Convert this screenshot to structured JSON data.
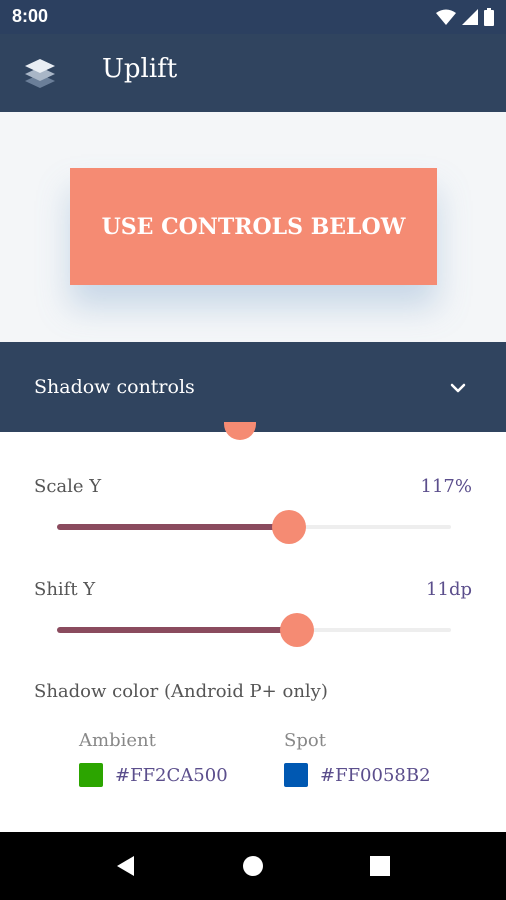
{
  "status": {
    "time": "8:00"
  },
  "app": {
    "title": "Uplift"
  },
  "preview": {
    "cta_label": "USE CONTROLS BELOW"
  },
  "panel": {
    "title": "Shadow controls"
  },
  "controls": {
    "scale_y": {
      "label": "Scale Y",
      "value": "117%",
      "fraction": 0.59
    },
    "shift_y": {
      "label": "Shift Y",
      "value": "11dp",
      "fraction": 0.61
    }
  },
  "shadow_color": {
    "heading": "Shadow color (Android P+ only)",
    "ambient": {
      "label": "Ambient",
      "hex": "#FF2CA500",
      "color": "#2ca500"
    },
    "spot": {
      "label": "Spot",
      "hex": "#FF0058B2",
      "color": "#0058b2"
    }
  },
  "theme": {
    "primary": "#30445f",
    "accent": "#f58b73",
    "slider_fill": "#8a4b5e"
  }
}
